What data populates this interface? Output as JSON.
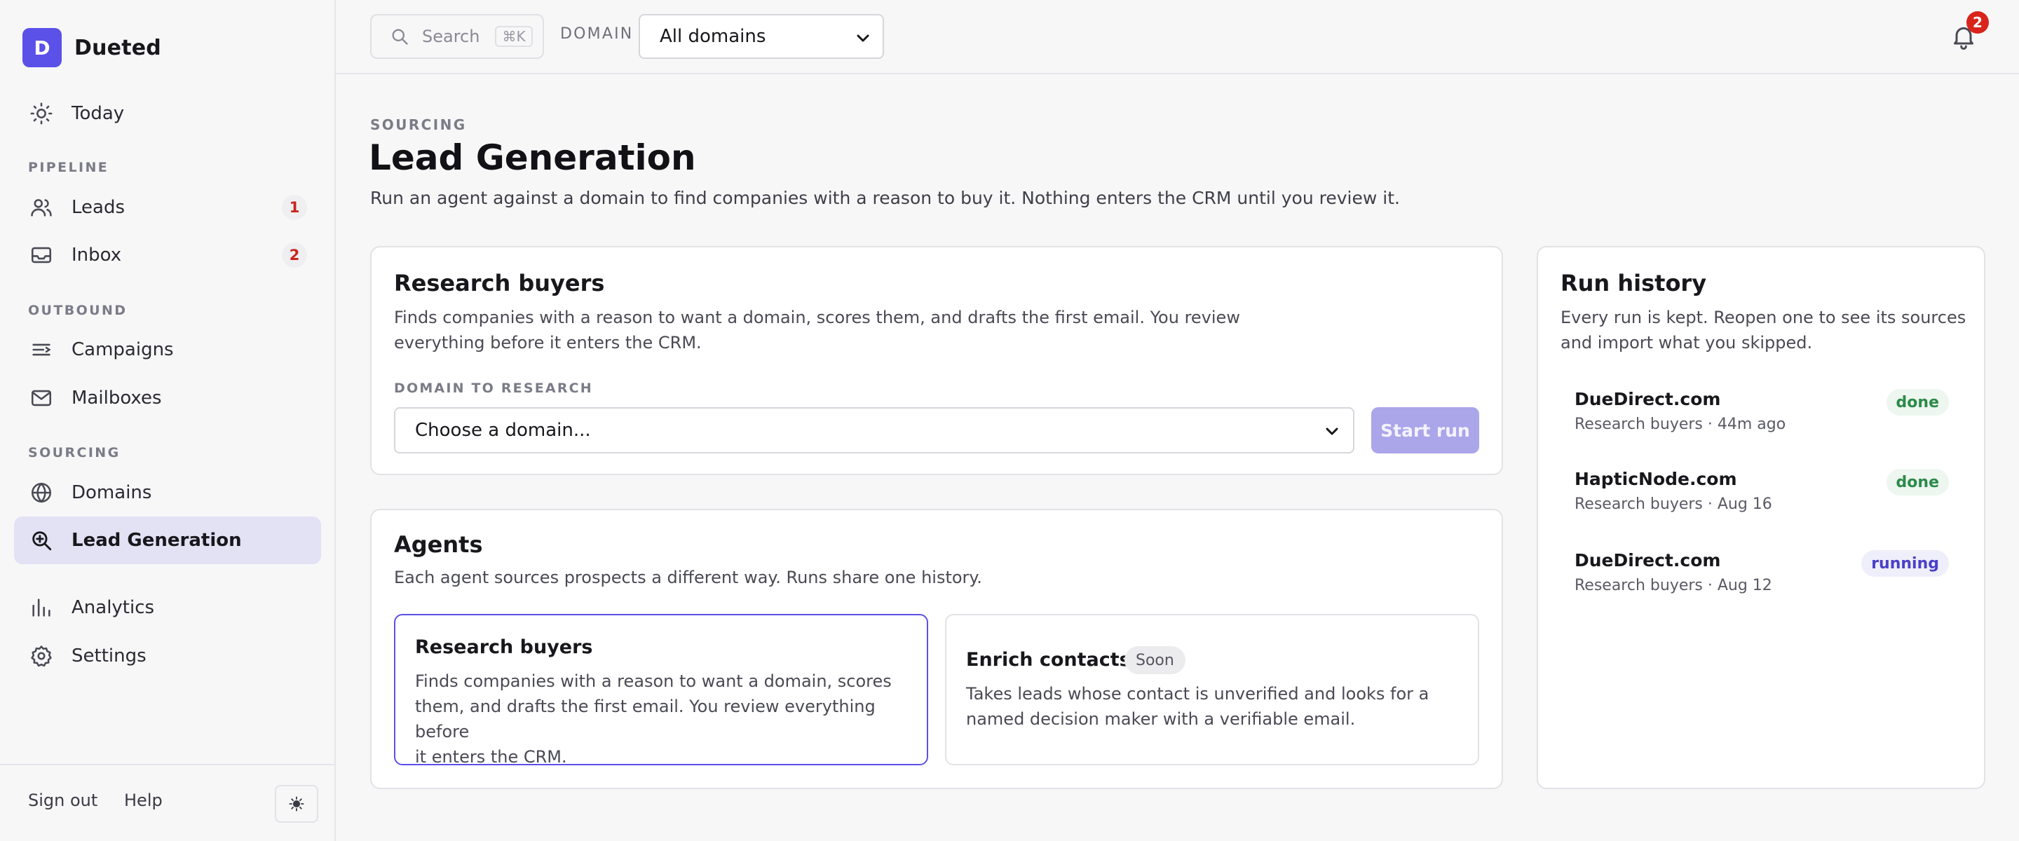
{
  "app": {
    "initial": "D",
    "name": "Dueted"
  },
  "sidebar": {
    "today": {
      "label": "Today",
      "icon": "sun-icon"
    },
    "sections": {
      "pipeline": "PIPELINE",
      "outbound": "OUTBOUND",
      "sourcing": "SOURCING"
    },
    "leads": {
      "label": "Leads",
      "badge": "1",
      "icon": "users-icon"
    },
    "inbox": {
      "label": "Inbox",
      "badge": "2",
      "icon": "inbox-icon"
    },
    "campaigns": {
      "label": "Campaigns",
      "icon": "list-icon"
    },
    "mailboxes": {
      "label": "Mailboxes",
      "icon": "mail-icon"
    },
    "domains": {
      "label": "Domains",
      "icon": "globe-icon"
    },
    "lead_generation": {
      "label": "Lead Generation",
      "icon": "search-plus-icon",
      "active": true
    },
    "analytics": {
      "label": "Analytics",
      "icon": "bar-chart-icon"
    },
    "settings": {
      "label": "Settings",
      "icon": "gear-icon"
    },
    "footer": {
      "sign_out": "Sign out",
      "help": "Help",
      "theme_icon": "sun-icon"
    }
  },
  "topbar": {
    "search_placeholder": "Search",
    "search_shortcut": "⌘K",
    "domain_label": "DOMAIN",
    "domain_value": "All domains",
    "notifications_count": "2"
  },
  "page": {
    "eyebrow": "SOURCING",
    "title": "Lead Generation",
    "subtitle": "Run an agent against a domain to find companies with a reason to buy it. Nothing enters the CRM until you review it."
  },
  "research_card": {
    "title": "Research buyers",
    "desc_line1": "Finds companies with a reason to want a domain, scores them, and drafts the first email. You review",
    "desc_line2": "everything before it enters the CRM.",
    "field_label": "DOMAIN TO RESEARCH",
    "select_value": "Choose a domain...",
    "button_label": "Start run"
  },
  "agents_card": {
    "title": "Agents",
    "desc": "Each agent sources prospects a different way. Runs share one history.",
    "agents": [
      {
        "title": "Research buyers",
        "desc_lines": [
          "Finds companies with a reason to want a domain, scores",
          "them, and drafts the first email. You review everything before",
          "it enters the CRM."
        ]
      },
      {
        "title": "Enrich contacts",
        "pill": "Soon",
        "desc_lines": [
          "Takes leads whose contact is unverified and looks for a",
          "named decision maker with a verifiable email."
        ]
      }
    ]
  },
  "run_history": {
    "title": "Run history",
    "desc_line1": "Every run is kept. Reopen one to see its sources",
    "desc_line2": "and import what you skipped.",
    "runs": [
      {
        "domain": "DueDirect.com",
        "meta": "Research buyers · 44m ago",
        "status": "done"
      },
      {
        "domain": "HapticNode.com",
        "meta": "Research buyers · Aug 16",
        "status": "done"
      },
      {
        "domain": "DueDirect.com",
        "meta": "Research buyers · Aug 12",
        "status": "running"
      }
    ]
  },
  "colors": {
    "accent": "#5b50e8",
    "done": "#2c8a4a",
    "running": "#4a40c9",
    "danger": "#d9241b"
  }
}
